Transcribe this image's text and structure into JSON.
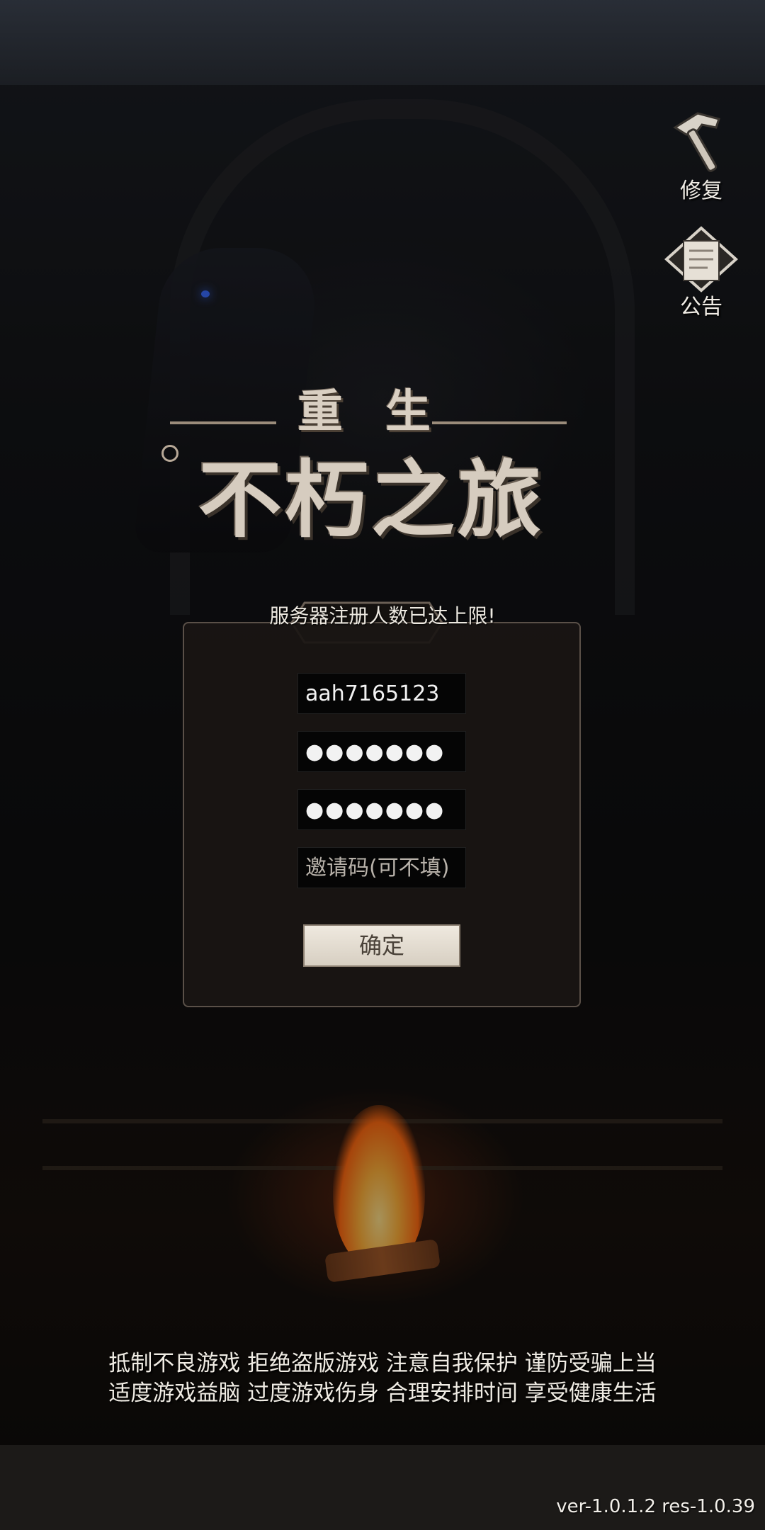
{
  "game": {
    "logo_small": "重生",
    "logo_big": "不朽之旅"
  },
  "side_buttons": {
    "repair_label": "修复",
    "announcement_label": "公告"
  },
  "notice": "服务器注册人数已达上限!",
  "register_panel": {
    "username_value": "aah7165123",
    "password_value": "●●●●●●●",
    "confirm_password_value": "●●●●●●●",
    "invite_code_placeholder": "邀请码(可不填)",
    "confirm_label": "确定"
  },
  "health_notice": {
    "line1": "抵制不良游戏 拒绝盗版游戏 注意自我保护 谨防受骗上当",
    "line2": "适度游戏益脑 过度游戏伤身 合理安排时间 享受健康生活"
  },
  "version": "ver-1.0.1.2 res-1.0.39",
  "icons": {
    "repair": "hammer-icon",
    "announcement": "scroll-icon"
  }
}
